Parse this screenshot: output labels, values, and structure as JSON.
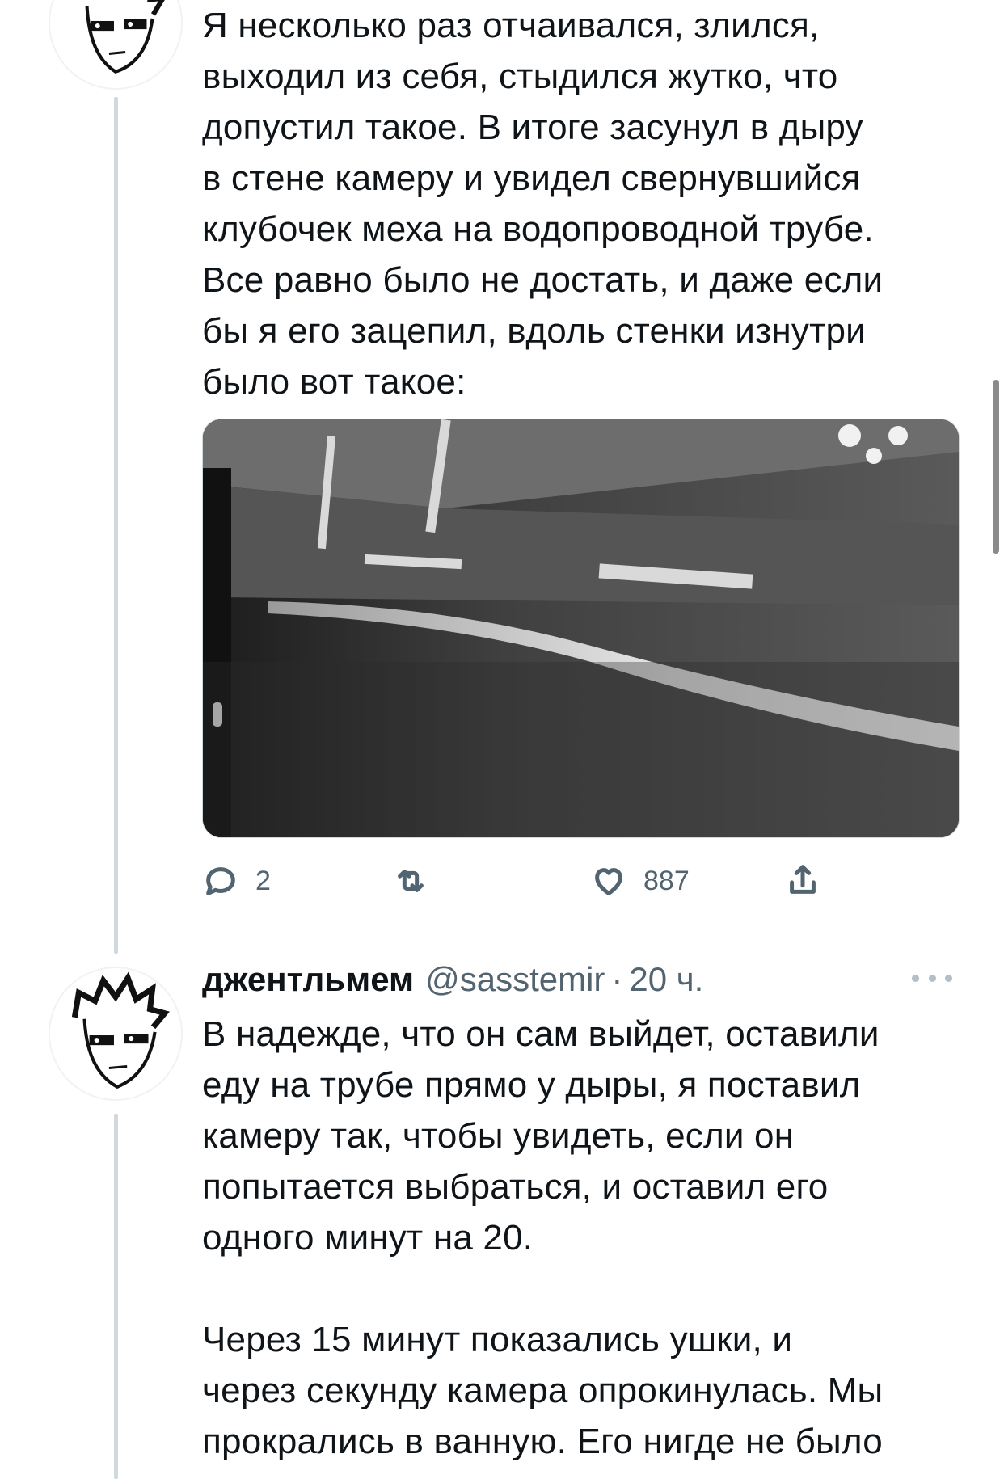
{
  "tweet1": {
    "text": "Я несколько раз отчаивался, злился,\nвыходил из себя, стыдился жутко, что\nдопустил такое. В итоге засунул в дыру\nв стене камеру и увидел свернувшийся\nклубочек меха на водопроводной трубе.\nВсе равно было не достать, и даже если\nбы я его зацепил, вдоль стенки изнутри\nбыло вот такое:",
    "actions": {
      "reply_count": "2",
      "retweet_count": "",
      "like_count": "887"
    }
  },
  "tweet2": {
    "author_name": "джентльмем",
    "author_handle": "@sasstemir",
    "separator": "·",
    "time": "20 ч.",
    "text": "В надежде, что он сам выйдет, оставили\nеду на трубе прямо у дыры, я поставил\nкамеру так, чтобы увидеть, если он\nпопытается выбраться, и оставил его\nодного минут на 20.\n\nЧерез 15 минут показались ушки, и\nчерез секунду камера опрокинулась. Мы\nпрокрались в ванную. Его нигде не было"
  },
  "icons": {
    "reply": "reply-icon",
    "retweet": "retweet-icon",
    "like": "heart-icon",
    "share": "share-icon",
    "more": "more-icon"
  },
  "colors": {
    "text": "#0f1419",
    "secondary": "#536471",
    "thread_line": "#cfd9de"
  }
}
